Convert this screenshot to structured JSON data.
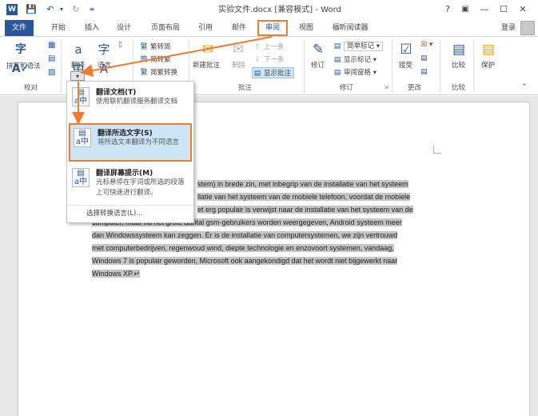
{
  "window": {
    "title": "实验文件.docx [兼容模式] - Word",
    "help": "?",
    "restore_ribbon": "🗗",
    "minimize": "—",
    "maximize": "☐",
    "close": "✕"
  },
  "quick_access": {
    "app_icon": "W",
    "save_icon": "save-icon",
    "undo_icon": "undo-icon",
    "redo_icon": "redo-icon",
    "customize_icon": "customize-icon"
  },
  "tabs": [
    "文件",
    "开始",
    "插入",
    "设计",
    "页面布局",
    "引用",
    "邮件",
    "审阅",
    "视图",
    "福昕阅读器"
  ],
  "login": "登录",
  "ribbon": {
    "proofing": {
      "spell_label": "拼写和语法",
      "group_label": "校对"
    },
    "language": {
      "translate_label": "翻译",
      "language_label": "语言",
      "arrow": "▾"
    },
    "chinese": {
      "trad": "繁转简",
      "simp": "简转繁",
      "convert": "简繁转换"
    },
    "comments": {
      "new_label": "新建批注",
      "delete_label": "删除",
      "prev": "上一条",
      "next": "下一条",
      "show": "显示批注",
      "group_label": "批注"
    },
    "tracking": {
      "track_label": "修订",
      "markup": "简单标记",
      "show_markup": "显示标记",
      "pane": "审阅窗格",
      "group_label": "修订"
    },
    "changes": {
      "accept_label": "接受",
      "group_label": "更改"
    },
    "compare": {
      "compare_label": "比较",
      "group_label": "比较"
    },
    "protect": {
      "protect_label": "保护"
    }
  },
  "menu": {
    "items": [
      {
        "title": "翻译文档(T)",
        "desc": "使用联机翻译服务翻译文档"
      },
      {
        "title": "翻译所选文字(S)",
        "desc": "将所选文本翻译为不同语言"
      },
      {
        "title": "翻译屏幕提示(M)",
        "desc": "光标悬停在字词或所选的段落上可快速进行翻译。"
      }
    ],
    "footer": "选择转换语言(L)..."
  },
  "document": {
    "lines": [
      "stem) in brede zin, met inbegrip van de installatie van het systeem",
      "llatie van het systeem van de mobiele telefoon, voordat de mobiele",
      "et erg populair is verwijst naar de installatie van het systeem van de",
      "computer, maar nu het grote aantal gsm-gebruikers worden weergegeven, Android systeem meer",
      "dan Windowssysteem kan zeggen. Er is de installatie van computersystemen, we zijn vertrouwd",
      "met computerbedrijven, regenwoud wind, diepte technologie en enzovoort systemen, vandaag,",
      "Windows 7 is populair geworden, Microsoft ook aangekondigd dat het wordt niet bijgewerkt naar",
      "Windows XP.↵"
    ]
  },
  "colors": {
    "accent": "#2b579a",
    "annotation": "#ed7d31",
    "selection": "#c6c6c6",
    "menu_highlight": "#cde6f7"
  }
}
